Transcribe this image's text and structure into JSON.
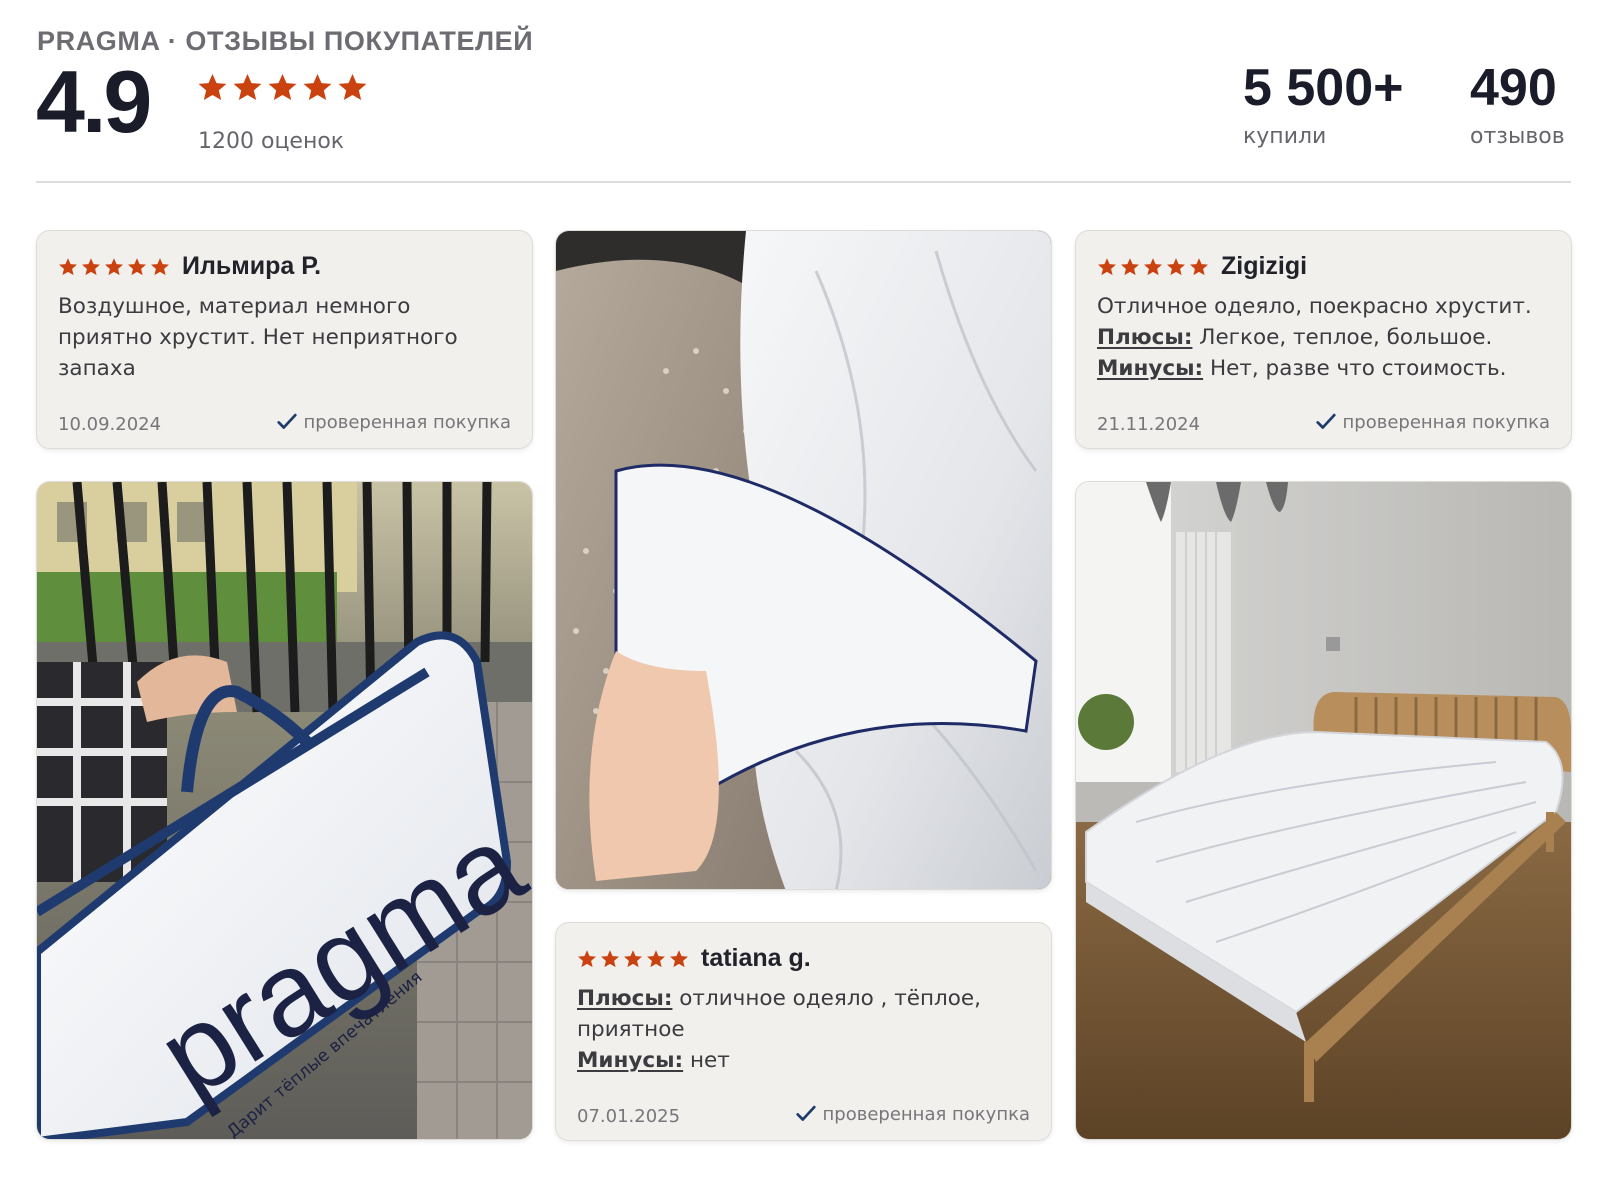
{
  "header": {
    "brand_title": "PRAGMA · ОТЗЫВЫ ПОКУПАТЕЛЕЙ",
    "rating": "4.9",
    "rating_stars": 5,
    "ratings_count_label": "1200 оценок",
    "stats": [
      {
        "value": "5 500+",
        "label": "купили"
      },
      {
        "value": "490",
        "label": "отзывов"
      }
    ]
  },
  "reviews": [
    {
      "stars": 5,
      "author": "Ильмира Р.",
      "text": "Воздушное, материал немного приятно хрустит. Нет неприятного запаха",
      "date": "10.09.2024",
      "verified_label": "проверенная покупка"
    },
    {
      "stars": 5,
      "author": "Zigizigi",
      "text": "Отличное одеяло, поекрасно хрустит.",
      "pros_label": "Плюсы:",
      "pros": "Легкое, теплое, большое.",
      "cons_label": "Минусы:",
      "cons": "Нет, разве что стоимость.",
      "date": "21.11.2024",
      "verified_label": "проверенная покупка"
    },
    {
      "stars": 5,
      "author": "tatiana g.",
      "pros_label": "Плюсы:",
      "pros": "отличное одеяло , тёплое, приятное",
      "cons_label": "Минусы:",
      "cons": "нет",
      "date": "07.01.2025",
      "verified_label": "проверенная покупка"
    }
  ],
  "photos": {
    "bag_brand_text": "pragma",
    "bag_slogan": "Дарит тёплые впечатления"
  },
  "colors": {
    "star": "#c9420f",
    "card_bg": "#f1f0ed",
    "title_dark": "#1b1c2a",
    "muted": "#66656c",
    "check": "#1e3c6b"
  }
}
